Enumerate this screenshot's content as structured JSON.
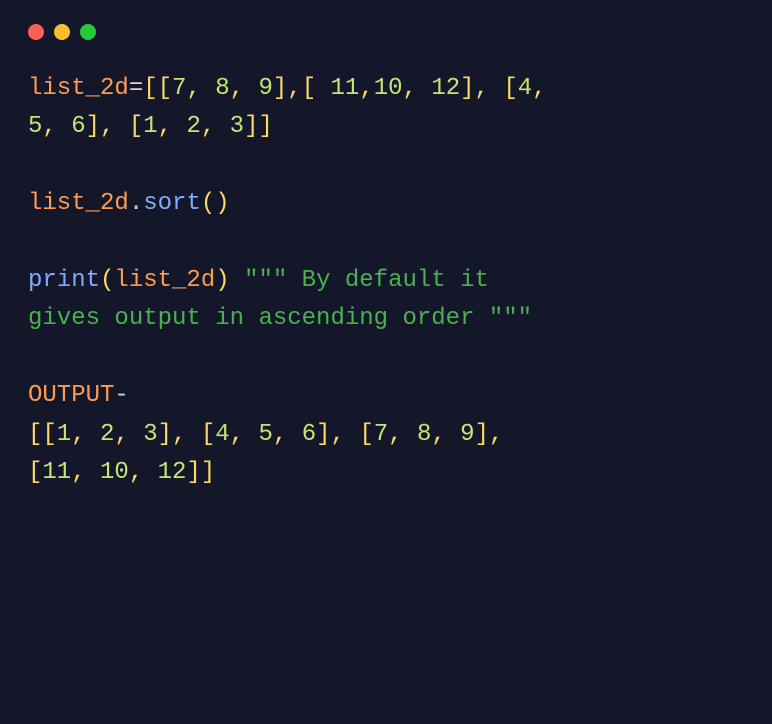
{
  "code": {
    "line1_var": "list_2d",
    "line1_assign": "=",
    "line1_p1": "[[",
    "line1_n1": "7",
    "line1_c1": ", ",
    "line1_n2": "8",
    "line1_c2": ", ",
    "line1_n3": "9",
    "line1_p2": "],[ ",
    "line1_n4": "11",
    "line1_c3": ",",
    "line1_n5": "10",
    "line1_c4": ", ",
    "line1_n6": "12",
    "line1_p3": "], [",
    "line1_n7": "4",
    "line1_c5": ", ",
    "line2_n1": "5",
    "line2_c1": ", ",
    "line2_n2": "6",
    "line2_p1": "], [",
    "line2_n3": "1",
    "line2_c2": ", ",
    "line2_n4": "2",
    "line2_c3": ", ",
    "line2_n5": "3",
    "line2_p2": "]]",
    "line4_var": "list_2d",
    "line4_dot": ".",
    "line4_method": "sort",
    "line4_paren": "()",
    "line6_func": "print",
    "line6_po": "(",
    "line6_var": "list_2d",
    "line6_pc": ")",
    "line6_sp": " ",
    "line6_str1": "\"\"\" By default it ",
    "line7_str": "gives output in ascending order \"\"\"",
    "line9_out": "OUTPUT",
    "line9_dash": "-",
    "line10_p1": "[[",
    "line10_n1": "1",
    "line10_c1": ", ",
    "line10_n2": "2",
    "line10_c2": ", ",
    "line10_n3": "3",
    "line10_p2": "], [",
    "line10_n4": "4",
    "line10_c3": ", ",
    "line10_n5": "5",
    "line10_c4": ", ",
    "line10_n6": "6",
    "line10_p3": "], [",
    "line10_n7": "7",
    "line10_c5": ", ",
    "line10_n8": "8",
    "line10_c6": ", ",
    "line10_n9": "9",
    "line10_p4": "], ",
    "line11_p1": "[",
    "line11_n1": "11",
    "line11_c1": ", ",
    "line11_n2": "10",
    "line11_c2": ", ",
    "line11_n3": "12",
    "line11_p2": "]]"
  }
}
